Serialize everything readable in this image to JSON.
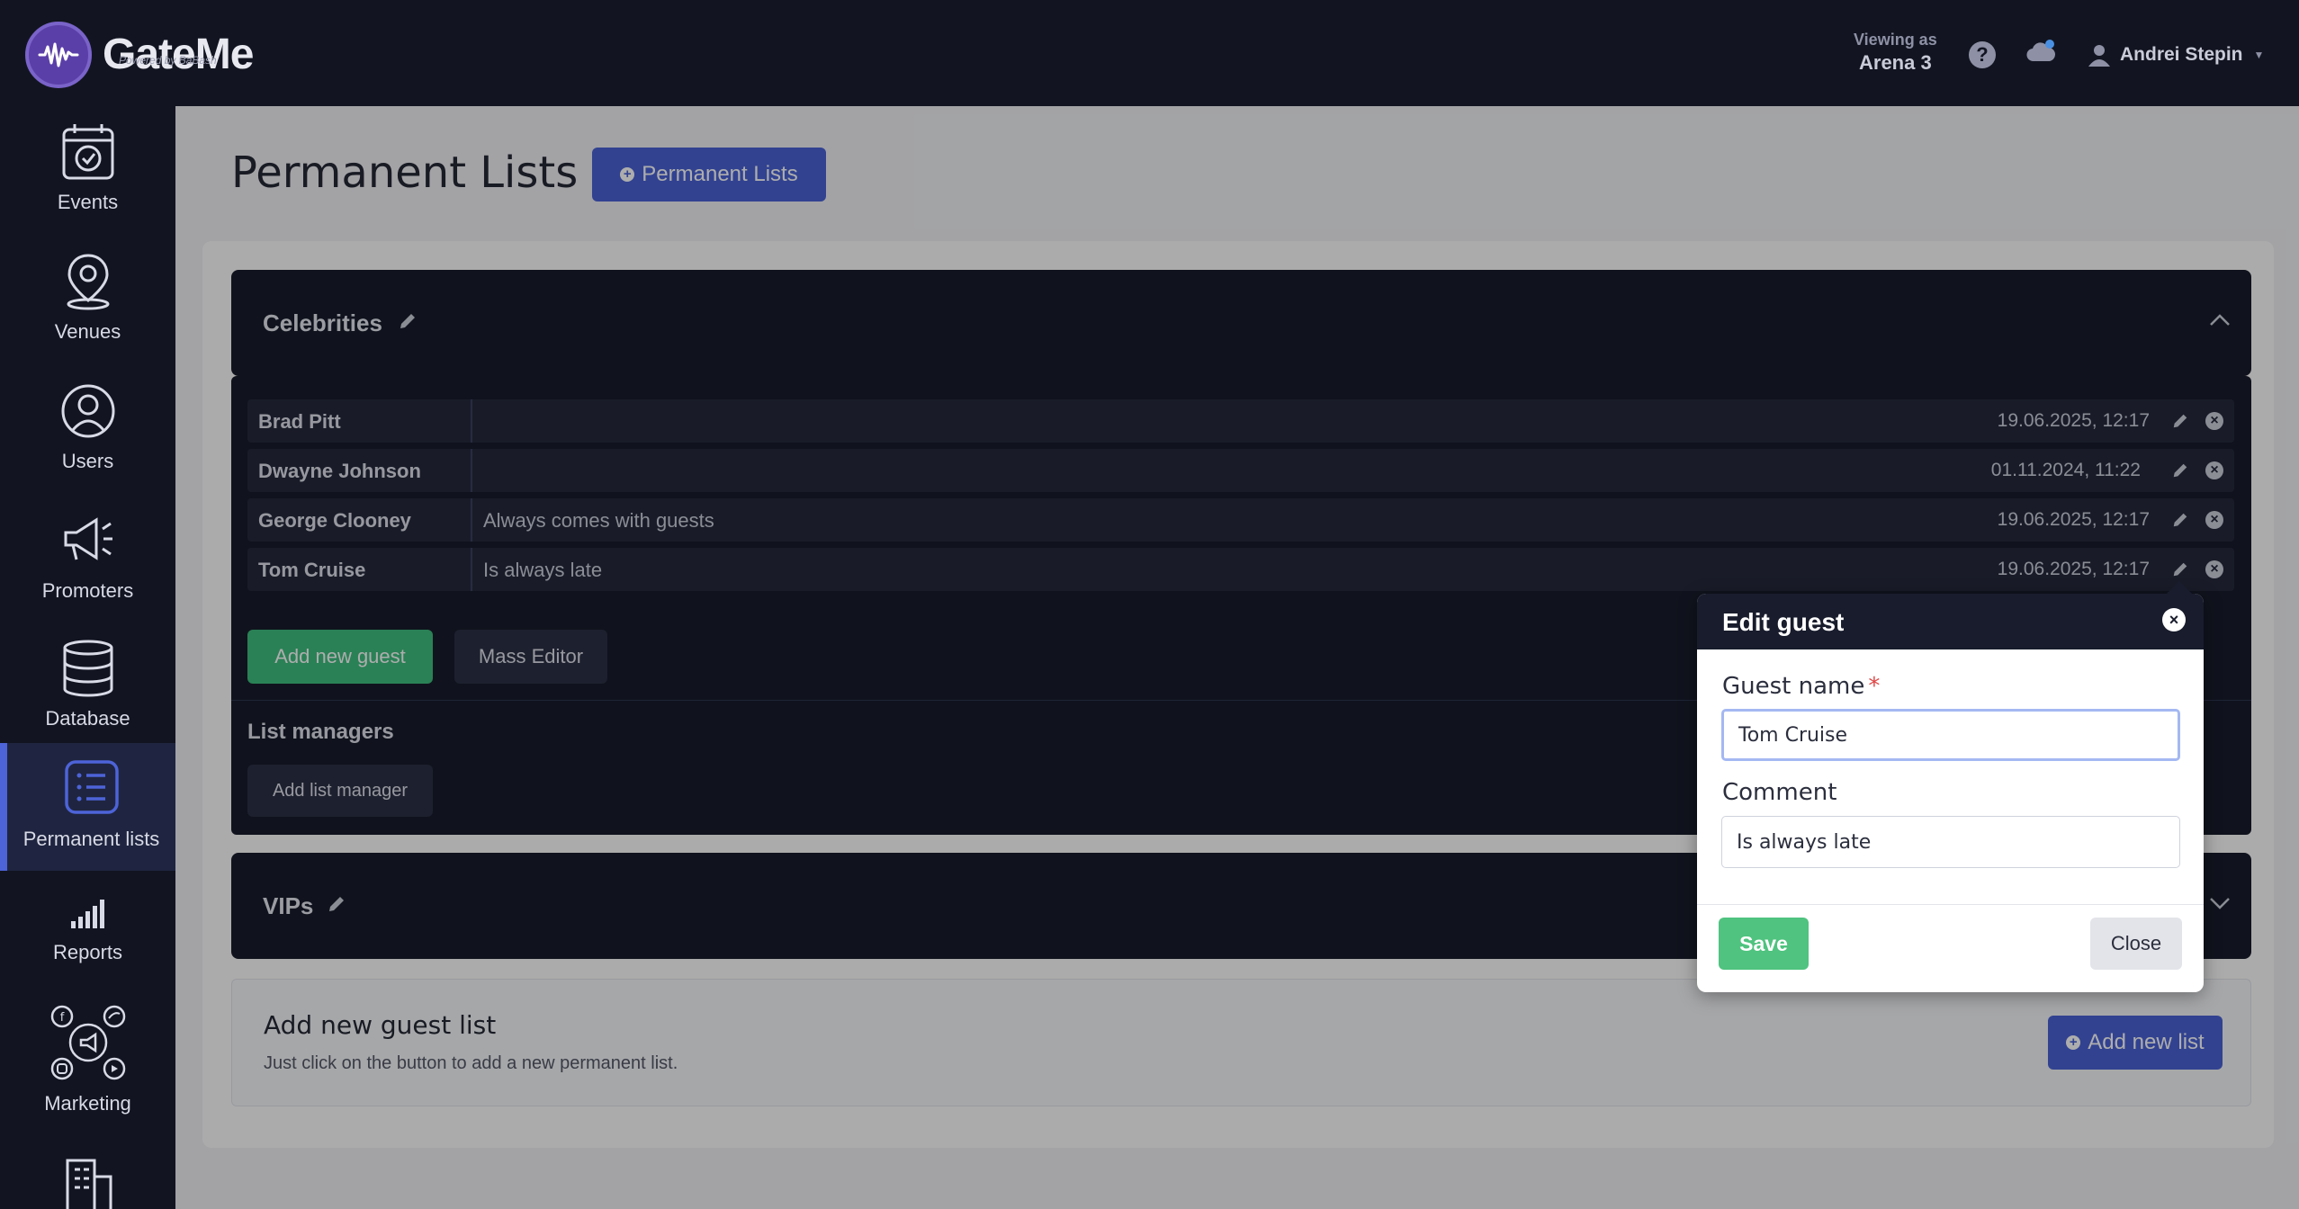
{
  "app": {
    "logo_text": "GateMe",
    "logo_subtext": "Powered by BaBash",
    "viewing_label": "Viewing as",
    "viewing_value": "Arena 3",
    "user_name": "Andrei Stepin"
  },
  "sidebar": {
    "items": [
      {
        "label": "Events",
        "icon": "calendar-icon"
      },
      {
        "label": "Venues",
        "icon": "map-pin-icon"
      },
      {
        "label": "Users",
        "icon": "user-icon"
      },
      {
        "label": "Promoters",
        "icon": "megaphone-icon"
      },
      {
        "label": "Database",
        "icon": "database-icon"
      },
      {
        "label": "Permanent lists",
        "icon": "list-icon",
        "active": true
      },
      {
        "label": "Reports",
        "icon": "bar-chart-icon"
      },
      {
        "label": "Marketing",
        "icon": "social-icon"
      }
    ]
  },
  "page": {
    "title": "Permanent Lists",
    "header_button": "Permanent Lists"
  },
  "lists": [
    {
      "name": "Celebrities",
      "expanded": true,
      "guests": [
        {
          "name": "Brad Pitt",
          "comment": "",
          "date": "19.06.2025, 12:17"
        },
        {
          "name": "Dwayne Johnson",
          "comment": "",
          "date": "01.11.2024, 11:22"
        },
        {
          "name": "George Clooney",
          "comment": "Always comes with guests",
          "date": "19.06.2025, 12:17"
        },
        {
          "name": "Tom Cruise",
          "comment": "Is always late",
          "date": "19.06.2025, 12:17"
        }
      ],
      "add_guest_label": "Add new guest",
      "mass_editor_label": "Mass Editor",
      "managers_title": "List managers",
      "add_manager_label": "Add list manager"
    },
    {
      "name": "VIPs",
      "expanded": false
    }
  ],
  "add_list": {
    "title": "Add new guest list",
    "subtitle": "Just click on the button to add a new permanent list.",
    "button": "Add new list"
  },
  "modal": {
    "title": "Edit guest",
    "name_label": "Guest name",
    "required_mark": "*",
    "name_value": "Tom Cruise",
    "comment_label": "Comment",
    "comment_value": "Is always late",
    "save_label": "Save",
    "close_label": "Close"
  },
  "colors": {
    "primary": "#4a62d6",
    "success": "#3fbf7f",
    "dark": "#181c2c"
  }
}
